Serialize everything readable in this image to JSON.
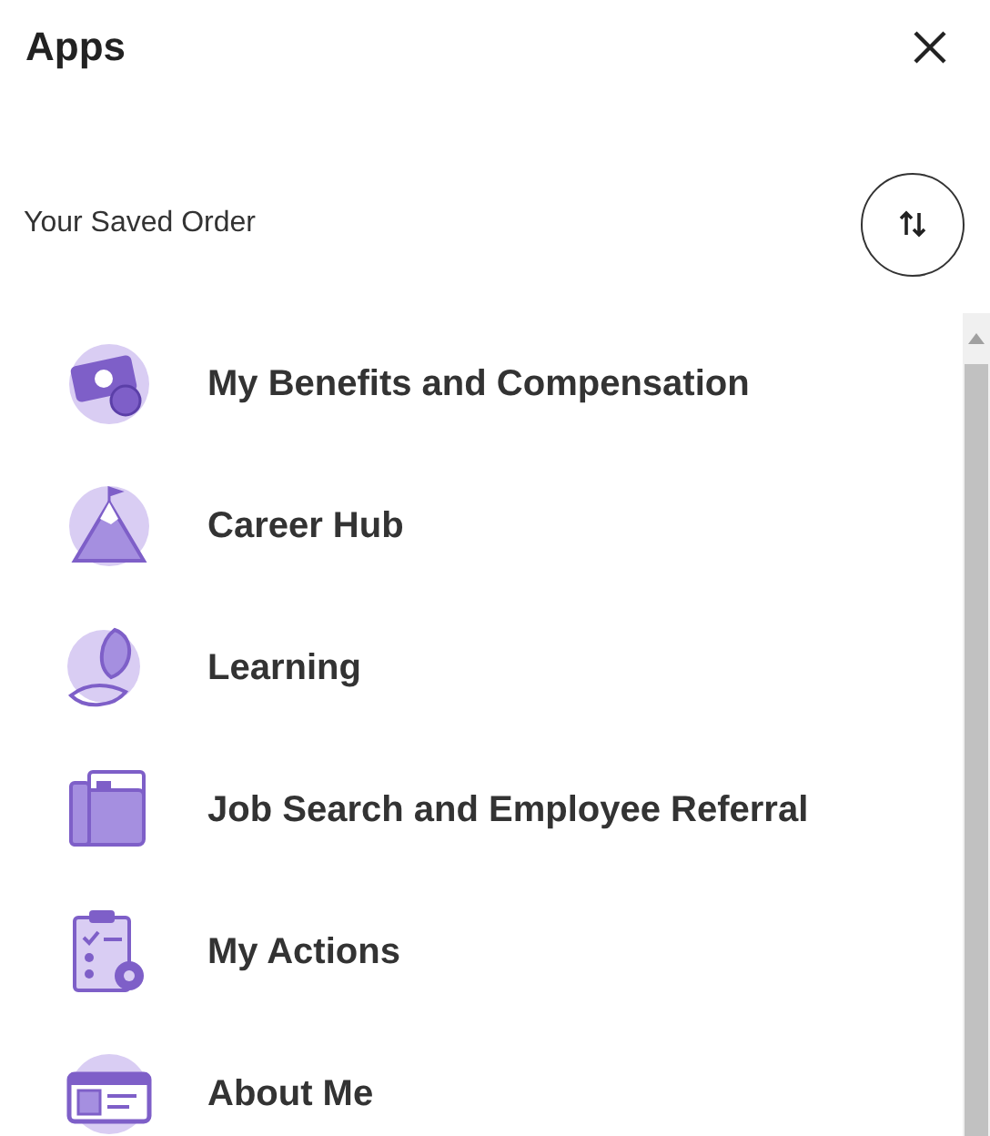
{
  "header": {
    "title": "Apps"
  },
  "order": {
    "label": "Your Saved Order"
  },
  "apps": [
    {
      "label": "My Benefits and Compensation"
    },
    {
      "label": "Career Hub"
    },
    {
      "label": "Learning"
    },
    {
      "label": "Job Search and Employee Referral"
    },
    {
      "label": "My Actions"
    },
    {
      "label": "About Me"
    }
  ]
}
